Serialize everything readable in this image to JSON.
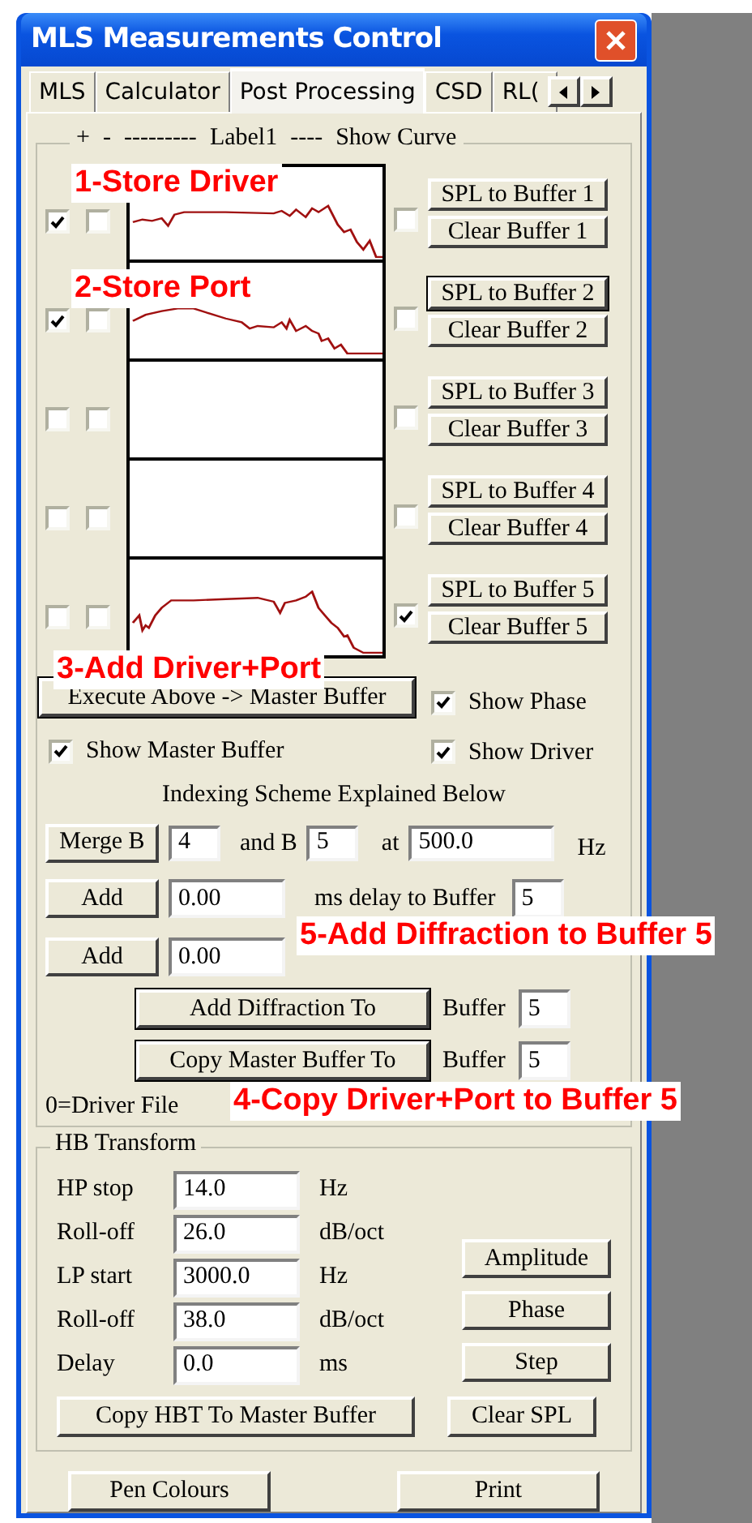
{
  "window": {
    "title": "MLS Measurements Control"
  },
  "tabs": [
    {
      "label": "MLS",
      "selected": false
    },
    {
      "label": "Calculator",
      "selected": false
    },
    {
      "label": "Post Processing",
      "selected": true
    },
    {
      "label": "CSD",
      "selected": false
    },
    {
      "label": "RL(",
      "selected": false
    }
  ],
  "buffers": {
    "header": [
      "+",
      "-",
      "---------",
      "Label1",
      "----",
      "Show Curve"
    ],
    "rows": [
      {
        "plus": true,
        "minus": false,
        "show_curve": false,
        "kind": "driver",
        "spl_button": {
          "label": "SPL to Buffer 1",
          "focused": false
        },
        "clear_button": "Clear Buffer 1"
      },
      {
        "plus": true,
        "minus": false,
        "show_curve": false,
        "kind": "port",
        "spl_button": {
          "label": "SPL to Buffer 2",
          "focused": true
        },
        "clear_button": "Clear Buffer 2"
      },
      {
        "plus": false,
        "minus": false,
        "show_curve": false,
        "kind": "empty",
        "spl_button": {
          "label": "SPL to Buffer 3",
          "focused": false
        },
        "clear_button": "Clear Buffer 3"
      },
      {
        "plus": false,
        "minus": false,
        "show_curve": false,
        "kind": "empty",
        "spl_button": {
          "label": "SPL to Buffer 4",
          "focused": false
        },
        "clear_button": "Clear Buffer 4"
      },
      {
        "plus": false,
        "minus": false,
        "show_curve": true,
        "kind": "sum",
        "spl_button": {
          "label": "SPL to Buffer 5",
          "focused": false
        },
        "clear_button": "Clear Buffer 5"
      }
    ]
  },
  "execute_button": "Execute Above -> Master Buffer",
  "options": [
    {
      "label": "Show Phase",
      "checked": true
    },
    {
      "label": "Show Driver",
      "checked": true
    },
    {
      "label": "Show Master Buffer",
      "checked": true
    }
  ],
  "indexing_note": "Indexing Scheme Explained Below",
  "merge": {
    "button": "Merge B",
    "buffer_a": "4",
    "and_label": "and B",
    "buffer_b": "5",
    "at_label": "at",
    "frequency": "500.0",
    "unit": "Hz"
  },
  "delay": {
    "button": "Add",
    "value": "0.00",
    "label": "ms delay to Buffer",
    "buffer": "5"
  },
  "add_second": {
    "button": "Add",
    "value": "0.00"
  },
  "diffraction": {
    "button": "Add Diffraction To",
    "label": "Buffer",
    "buffer": "5"
  },
  "copy_master": {
    "button": "Copy Master Buffer To",
    "label": "Buffer",
    "buffer": "5"
  },
  "index_legend": "0=Driver File",
  "hb_transform": {
    "title": "HB Transform",
    "params": [
      {
        "label": "HP stop",
        "value": "14.0",
        "unit": "Hz"
      },
      {
        "label": "Roll-off",
        "value": "26.0",
        "unit": "dB/oct"
      },
      {
        "label": "LP start",
        "value": "3000.0",
        "unit": "Hz"
      },
      {
        "label": "Roll-off",
        "value": "38.0",
        "unit": "dB/oct"
      },
      {
        "label": "Delay",
        "value": "0.0",
        "unit": "ms"
      }
    ],
    "copy_button": "Copy HBT To Master Buffer",
    "view_buttons": [
      "Amplitude",
      "Phase",
      "Step",
      "Clear SPL"
    ]
  },
  "footer_buttons": [
    "Pen Colours",
    "Print"
  ],
  "annotations": [
    "1-Store Driver",
    "2-Store Port",
    "3-Add Driver+Port",
    "5-Add Diffraction to Buffer 5",
    "4-Copy Driver+Port to Buffer 5"
  ]
}
